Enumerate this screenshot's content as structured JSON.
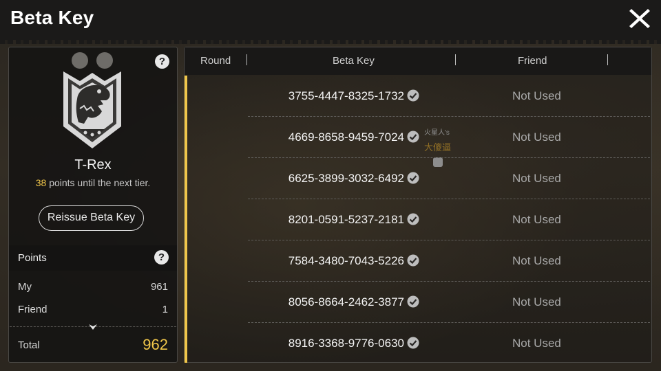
{
  "window": {
    "title": "Beta Key"
  },
  "profile": {
    "tier_name": "T-Rex",
    "points_until_next": "38",
    "points_until_next_suffix": "points until the next tier.",
    "reissue_label": "Reissue Beta Key",
    "help_symbol": "?"
  },
  "points": {
    "header": "Points",
    "help_symbol": "?",
    "rows": [
      {
        "label": "My",
        "value": "961"
      },
      {
        "label": "Friend",
        "value": "1"
      }
    ],
    "total_label": "Total",
    "total_value": "962"
  },
  "table": {
    "columns": [
      "Round",
      "Beta Key",
      "Friend"
    ],
    "rows": [
      {
        "key": "3755-4447-8325-1732",
        "friend": "Not Used"
      },
      {
        "key": "4669-8658-9459-7024",
        "friend": "Not Used"
      },
      {
        "key": "6625-3899-3032-6492",
        "friend": "Not Used"
      },
      {
        "key": "8201-0591-5237-2181",
        "friend": "Not Used"
      },
      {
        "key": "7584-3480-7043-5226",
        "friend": "Not Used"
      },
      {
        "key": "8056-8664-2462-3877",
        "friend": "Not Used"
      },
      {
        "key": "8916-3368-9776-0630",
        "friend": "Not Used"
      }
    ]
  },
  "background_overlay": {
    "line1": "火星人's",
    "line2": "大傻逼"
  },
  "colors": {
    "accent": "#f0c64a",
    "header_bg": "#1b1a19",
    "panel_bg": "#161514"
  },
  "icons": [
    "close-icon",
    "help-icon",
    "t-rex-badge-icon",
    "check-circle-icon",
    "chevron-down-icon"
  ]
}
